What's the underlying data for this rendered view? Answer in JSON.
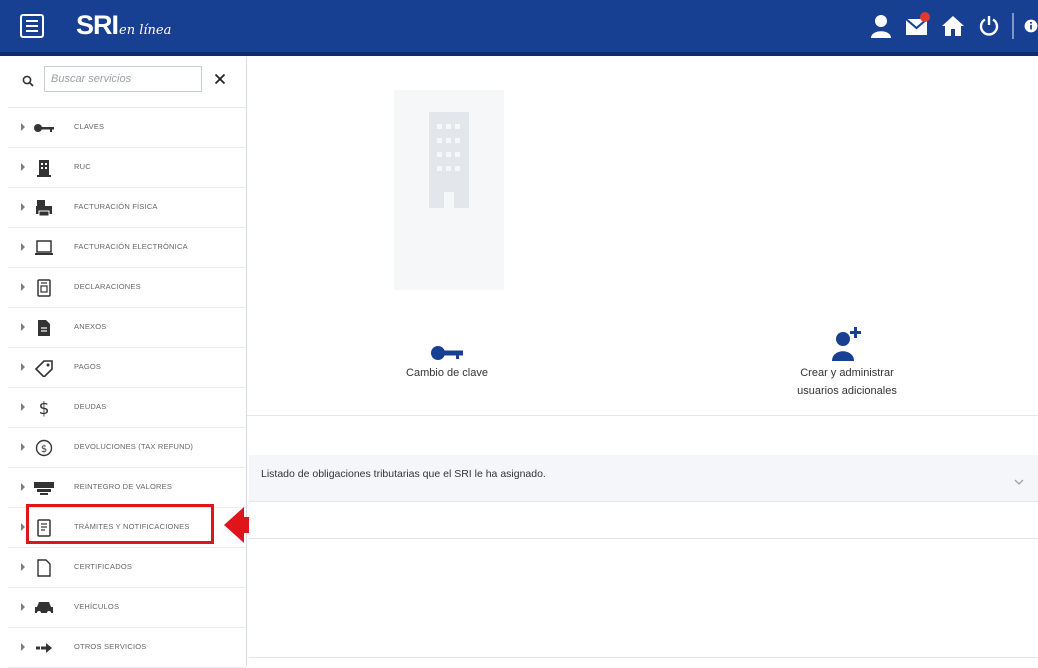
{
  "header": {
    "logo_main": "SRI",
    "logo_sub": "en línea",
    "brand_color": "#173f92",
    "icons": [
      "user-icon",
      "mail-icon",
      "home-icon",
      "power-icon",
      "info-icon"
    ]
  },
  "sidebar": {
    "search": {
      "placeholder": "Buscar servicios",
      "value": ""
    },
    "items": [
      {
        "label": "CLAVES",
        "icon": "key-icon"
      },
      {
        "label": "RUC",
        "icon": "building-icon"
      },
      {
        "label": "FACTURACIÓN FÍSICA",
        "icon": "printer-icon"
      },
      {
        "label": "FACTURACIÓN ELECTRÓNICA",
        "icon": "laptop-icon"
      },
      {
        "label": "DECLARACIONES",
        "icon": "document-icon"
      },
      {
        "label": "ANEXOS",
        "icon": "file-icon"
      },
      {
        "label": "PAGOS",
        "icon": "tag-icon"
      },
      {
        "label": "DEUDAS",
        "icon": "dollar-icon"
      },
      {
        "label": "DEVOLUCIONES (TAX REFUND)",
        "icon": "refund-icon"
      },
      {
        "label": "REINTEGRO DE VALORES",
        "icon": "money-icon"
      },
      {
        "label": "TRÁMITES Y NOTIFICACIONES",
        "icon": "notification-doc-icon"
      },
      {
        "label": "CERTIFICADOS",
        "icon": "certificate-icon"
      },
      {
        "label": "VEHÍCULOS",
        "icon": "car-icon"
      },
      {
        "label": "OTROS SERVICIOS",
        "icon": "arrow-right-icon"
      }
    ]
  },
  "main": {
    "services": [
      {
        "label": "Cambio de clave",
        "icon": "key-icon"
      },
      {
        "label_line1": "Crear y administrar",
        "label_line2": "usuarios adicionales",
        "icon": "add-user-icon"
      }
    ],
    "obligations_panel": {
      "title": "Listado de obligaciones tributarias que el SRI le ha asignado."
    }
  },
  "annotation": {
    "highlight_color": "#e0141b",
    "highlighted_item": "TRÁMITES Y NOTIFICACIONES"
  }
}
